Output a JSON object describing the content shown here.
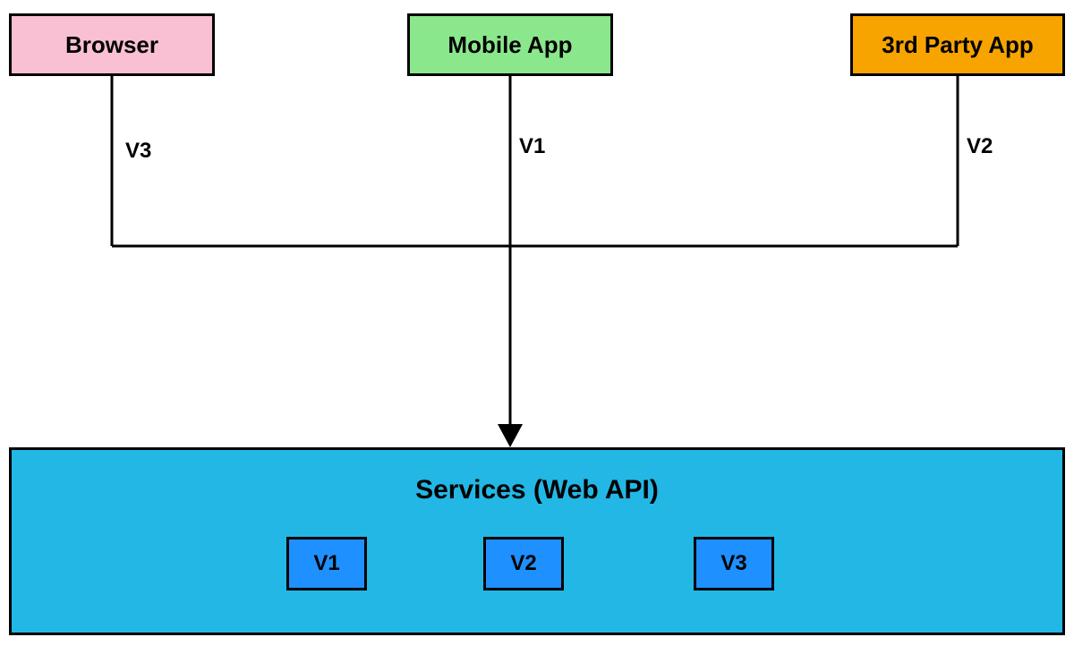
{
  "clients": {
    "browser": {
      "label": "Browser",
      "version_label": "V3",
      "color": "#f8c0d2"
    },
    "mobile": {
      "label": "Mobile App",
      "version_label": "V1",
      "color": "#8be78b"
    },
    "thirdparty": {
      "label": "3rd Party App",
      "version_label": "V2",
      "color": "#f7a400"
    }
  },
  "services": {
    "title": "Services (Web API)",
    "color": "#23b7e5",
    "versions": [
      {
        "label": "V1"
      },
      {
        "label": "V2"
      },
      {
        "label": "V3"
      }
    ],
    "inner_color": "#1e90ff"
  },
  "diagram": {
    "description": "Three client applications (Browser using V3, Mobile App using V1, 3rd Party App using V2) connect via a merged connector with an arrowhead into a single Services (Web API) component that hosts versions V1, V2, V3.",
    "arrow_direction": "down"
  }
}
